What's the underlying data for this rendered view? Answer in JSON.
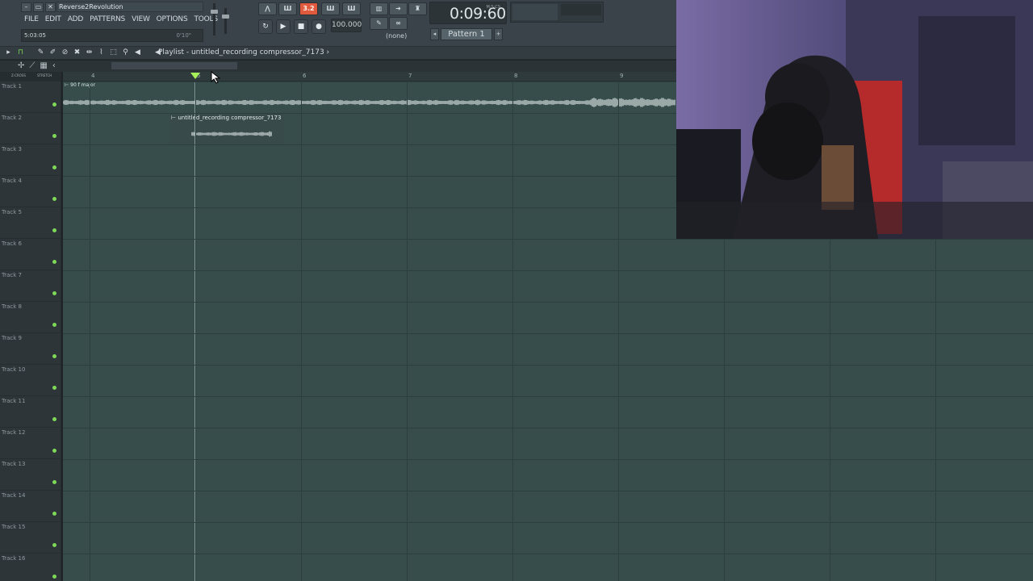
{
  "window": {
    "project_title": "Reverse2Revolution",
    "controls": [
      "–",
      "▭",
      "✕"
    ]
  },
  "menu": [
    "FILE",
    "EDIT",
    "ADD",
    "PATTERNS",
    "VIEW",
    "OPTIONS",
    "TOOLS",
    "?"
  ],
  "hint_bar": {
    "left": "5:03:05",
    "right": "0'10\""
  },
  "transport": {
    "tempo": "100.000",
    "snap": "(none)",
    "time": "0:09:60",
    "time_unit": "M:S:CS",
    "pattern": "Pattern 1",
    "pattern_prev": "◂",
    "pattern_next": "+"
  },
  "playlist": {
    "title": "Playlist - untitled_recording compressor_7173",
    "title_arrow": "›",
    "header_labels": [
      "Z-CROSS",
      "STRETCH"
    ],
    "bar_numbers": [
      "4",
      "5",
      "6",
      "7",
      "8",
      "9"
    ],
    "tracks": [
      "Track 1",
      "Track 2",
      "Track 3",
      "Track 4",
      "Track 5",
      "Track 6",
      "Track 7",
      "Track 8",
      "Track 9",
      "Track 10",
      "Track 11",
      "Track 12",
      "Track 13",
      "Track 14",
      "Track 15",
      "Track 16"
    ],
    "clips": [
      {
        "label": "⊢ 90 f major"
      },
      {
        "label": "⊢ untitled_recording compressor_7173"
      }
    ]
  },
  "colors": {
    "accent_red": "#e05a3e",
    "grid": "#364d4c",
    "track_led": "#7ed957",
    "playhead_marker": "#a8f05a"
  }
}
